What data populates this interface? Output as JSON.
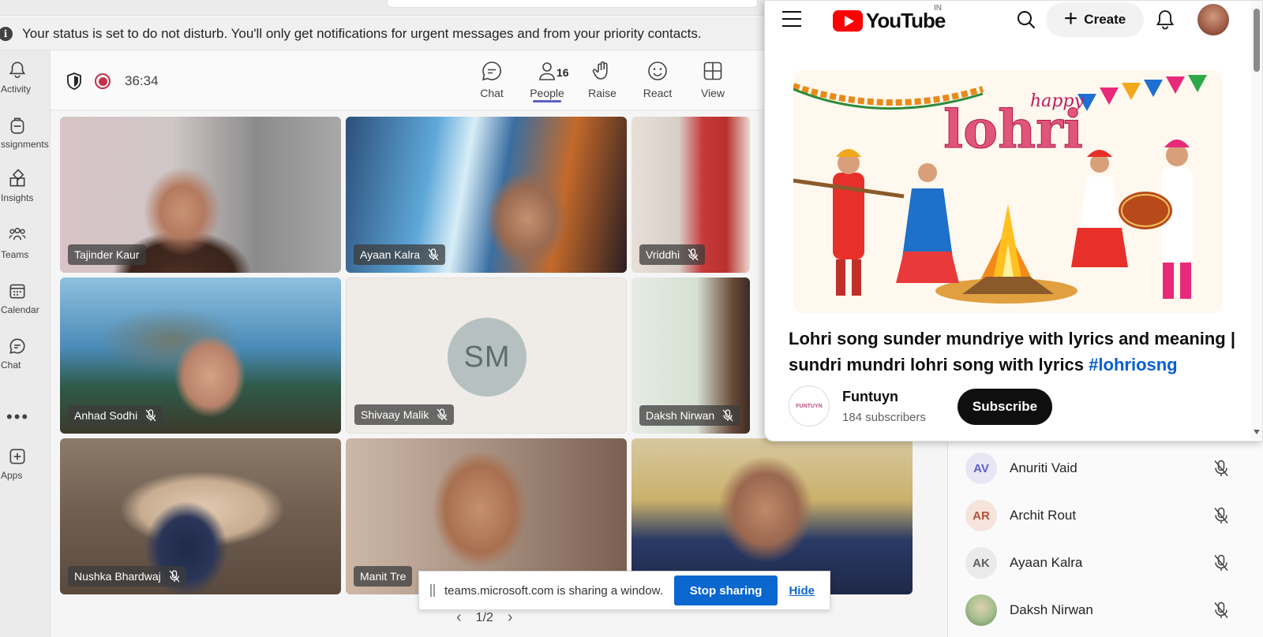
{
  "status_banner": {
    "text": "Your status is set to do not disturb. You'll only get notifications for urgent messages and from your priority contacts."
  },
  "rail": {
    "items": [
      {
        "label": "Activity",
        "icon": "bell-icon"
      },
      {
        "label": "ssignments",
        "icon": "backpack-icon"
      },
      {
        "label": "Insights",
        "icon": "insights-icon"
      },
      {
        "label": "Teams",
        "icon": "teams-icon"
      },
      {
        "label": "Calendar",
        "icon": "calendar-icon"
      },
      {
        "label": "Chat",
        "icon": "chat-icon"
      },
      {
        "label": "Apps",
        "icon": "apps-icon"
      }
    ],
    "more": "•••"
  },
  "meeting": {
    "timer": "36:34",
    "buttons": {
      "chat": "Chat",
      "people": "People",
      "people_count": "16",
      "raise": "Raise",
      "react": "React",
      "view": "View"
    }
  },
  "tiles": [
    {
      "name": "Tajinder Kaur"
    },
    {
      "name": "Ayaan Kalra"
    },
    {
      "name": "Vriddhi"
    },
    {
      "name": "Anhad Sodhi"
    },
    {
      "name": "Shivaay Malik",
      "initials": "SM"
    },
    {
      "name": "Daksh Nirwan"
    },
    {
      "name": "Nushka Bhardwaj"
    },
    {
      "name": "Manit Tre"
    },
    {
      "name": ""
    }
  ],
  "pager": {
    "label": "1/2"
  },
  "participants": [
    {
      "initials": "AV",
      "name": "Anuriti Vaid",
      "color": "#e8e6f4",
      "text_color": "#5b5fc7"
    },
    {
      "initials": "AR",
      "name": "Archit Rout",
      "color": "#f6e4dc",
      "text_color": "#b1533a"
    },
    {
      "initials": "AK",
      "name": "Ayaan Kalra",
      "color": "#eaeaea",
      "text_color": "#616161"
    },
    {
      "initials": "",
      "name": "Daksh Nirwan",
      "color": "#c9d8b0",
      "text_color": "#616161"
    }
  ],
  "share_bar": {
    "message": "teams.microsoft.com is sharing a window.",
    "stop": "Stop sharing",
    "hide": "Hide"
  },
  "youtube": {
    "logo": "YouTube",
    "region": "IN",
    "create": "Create",
    "video_title": "Lohri song sunder mundriye with lyrics and meaning | sundri mundri lohri song with lyrics",
    "hashtag": "#lohriosng",
    "channel": "Funtuyn",
    "subscribers": "184 subscribers",
    "subscribe": "Subscribe",
    "thumbnail_text": {
      "happy": "happy",
      "lohri": "lohri"
    },
    "channel_logo_text": "FUNTUYN"
  },
  "colors": {
    "accent": "#5b5fc7",
    "record": "#c4314b",
    "share_blue": "#0b67d0",
    "youtube_red": "#ff0000"
  }
}
